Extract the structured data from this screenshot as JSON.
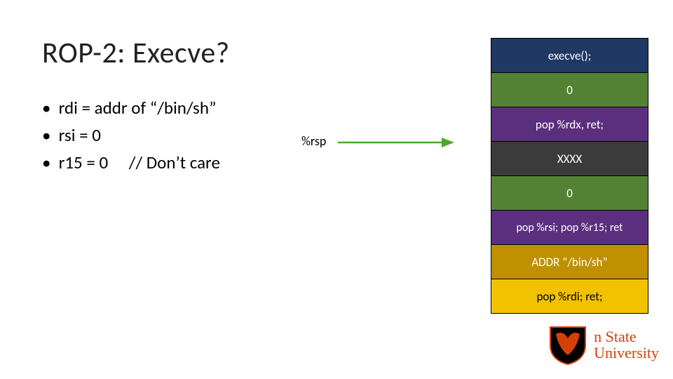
{
  "title": "ROP-2: Execve?",
  "bullets": {
    "b1": "rdi = addr of “/bin/sh”",
    "b2": "rsi = 0",
    "b3_left": "r15 = 0",
    "b3_right": "// Don’t care"
  },
  "pointer_label": "%rsp",
  "stack": {
    "s0": "execve();",
    "s1": "0",
    "s2": "pop %rdx, ret;",
    "s3": "XXXX",
    "s4": "0",
    "s5": "pop %rsi; pop %r15; ret",
    "s6": "ADDR “/bin/sh”",
    "s7": "pop %rdi; ret;"
  },
  "logo": {
    "line1": "n State",
    "line2": "University"
  },
  "colors": {
    "orange": "#d73f09",
    "stack_border": "#000000"
  }
}
